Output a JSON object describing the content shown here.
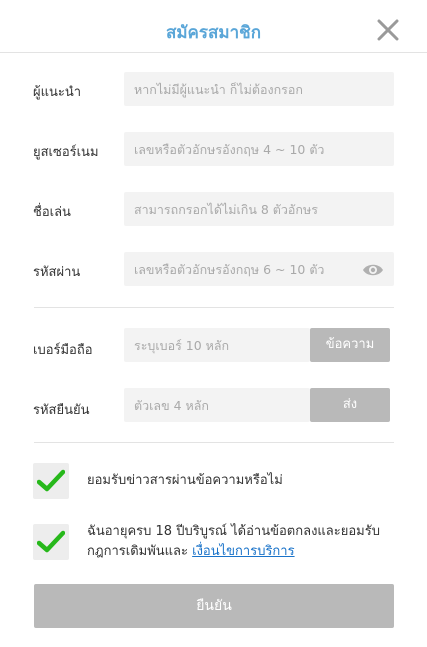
{
  "header": {
    "title": "สมัครสมาชิก",
    "close_icon": "close-icon"
  },
  "form": {
    "referrer": {
      "label": "ผู้แนะนำ",
      "placeholder": "หากไม่มีผู้แนะนำ ก็ไม่ต้องกรอก",
      "value": ""
    },
    "username": {
      "label": "ยูสเซอร์เนม",
      "placeholder": "เลขหรือตัวอักษรอังกฤษ 4 ~ 10 ตัว",
      "value": ""
    },
    "nickname": {
      "label": "ชื่อเล่น",
      "placeholder": "สามารถกรอกได้ไม่เกิน 8 ตัวอักษร",
      "value": ""
    },
    "password": {
      "label": "รหัสผ่าน",
      "placeholder": "เลขหรือตัวอักษรอังกฤษ 6 ~ 10 ตัว",
      "value": "",
      "eye_icon": "eye-icon"
    },
    "phone": {
      "label": "เบอร์มือถือ",
      "placeholder": "ระบุเบอร์ 10 หลัก",
      "value": "",
      "button": "ข้อความ"
    },
    "verify": {
      "label": "รหัสยืนยัน",
      "placeholder": "ตัวเลข 4 หลัก",
      "value": "",
      "button": "ส่ง"
    }
  },
  "options": {
    "news": {
      "text": "ยอมรับข่าวสารผ่านข้อความหรือไม่",
      "checked": true
    },
    "terms": {
      "line1": "ฉันอายุครบ 18 ปีบริบูรณ์ ได้อ่านข้อตกลงและยอมรับ",
      "line2_prefix": "กฎการเดิมพันและ ",
      "link": "เงื่อนไขการบริการ",
      "checked": true
    }
  },
  "submit_label": "ยืนยัน",
  "colors": {
    "title": "#5aa6d8",
    "check": "#27b81b",
    "button": "#b9b9b9",
    "link": "#1a73c9"
  }
}
